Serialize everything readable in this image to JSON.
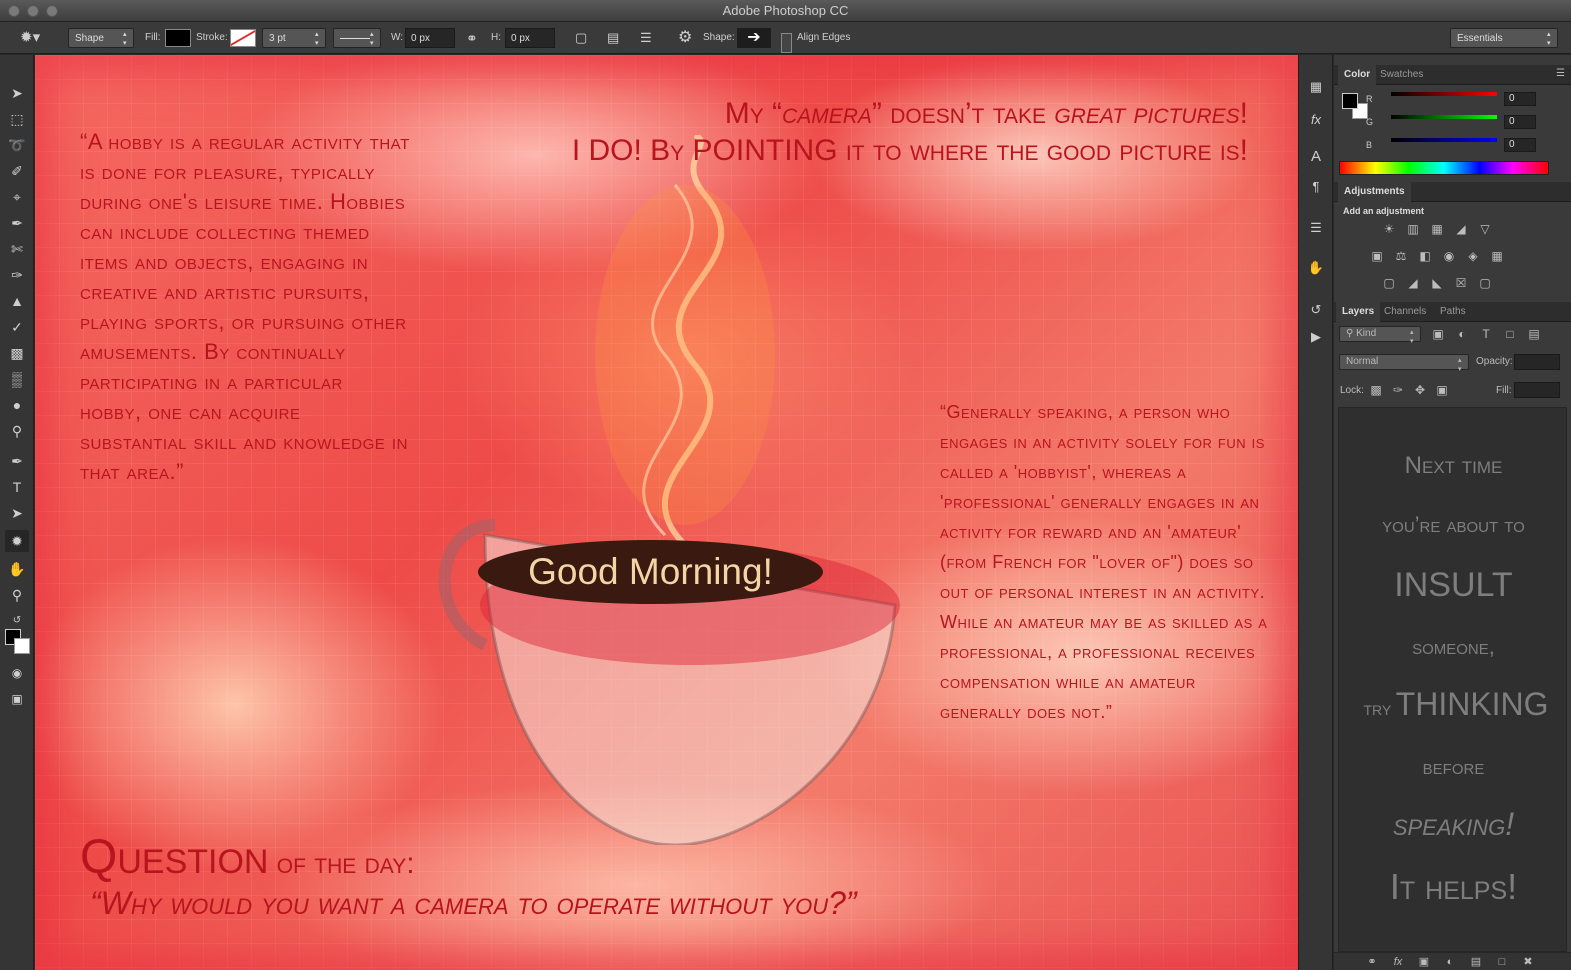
{
  "window": {
    "title": "Adobe Photoshop CC"
  },
  "options": {
    "mode": "Shape",
    "fill_label": "Fill:",
    "stroke_label": "Stroke:",
    "stroke_width": "3 pt",
    "w_label": "W:",
    "w_value": "0 px",
    "h_label": "H:",
    "h_value": "0 px",
    "shape_label": "Shape:",
    "align_edges": "Align Edges",
    "workspace": "Essentials"
  },
  "artwork": {
    "headline_pre": "My “",
    "headline_camera": "camera",
    "headline_mid": "” doesn’t take ",
    "headline_great": "great pictures",
    "headline_end": "!",
    "headline_line2": "I DO! By POINTING it to where the good picture is!",
    "quote_left": "“A hobby is a regular activity that is done for pleasure, typically during one's leisure time. Hobbies can include collecting themed items and objects, engaging in creative and artistic pursuits, playing sports, or pursuing other amusements. By continually participating in a particular hobby, one can acquire substantial skill and knowledge in that area.”",
    "quote_right": "“Generally speaking, a person who engages in an activity solely for fun is called a 'hobbyist', whereas a 'professional' generally engages in an activity for reward and an 'amateur' (from French for \"lover of\") does so out of personal interest in an activity. While an amateur may be as skilled as a professional, a professional receives compensation while an amateur generally does not.”",
    "greeting": "Good Morning!",
    "qod_big": "Question",
    "qod_small": " of the day:",
    "qod_question": "“Why would you want a camera to operate without you?”"
  },
  "color_panel": {
    "tabs": [
      "Color",
      "Swatches"
    ],
    "r_label": "R",
    "g_label": "G",
    "b_label": "B",
    "r": "0",
    "g": "0",
    "b": "0"
  },
  "adjustments_panel": {
    "tab": "Adjustments",
    "heading": "Add an adjustment"
  },
  "layers_panel": {
    "tabs": [
      "Layers",
      "Channels",
      "Paths"
    ],
    "filter": "Kind",
    "blend_mode": "Normal",
    "opacity_label": "Opacity:",
    "lock_label": "Lock:",
    "fill_label": "Fill:",
    "layer_text": [
      "Next time",
      "you’re about to",
      "INSULT",
      "someone,",
      "try",
      "THINKING",
      "before",
      "speaking!",
      "It helps!"
    ]
  },
  "colors": {
    "accent_text": "#b8141e",
    "greeting_bg": "#3a1a10",
    "greeting_text": "#f4d6a6"
  }
}
